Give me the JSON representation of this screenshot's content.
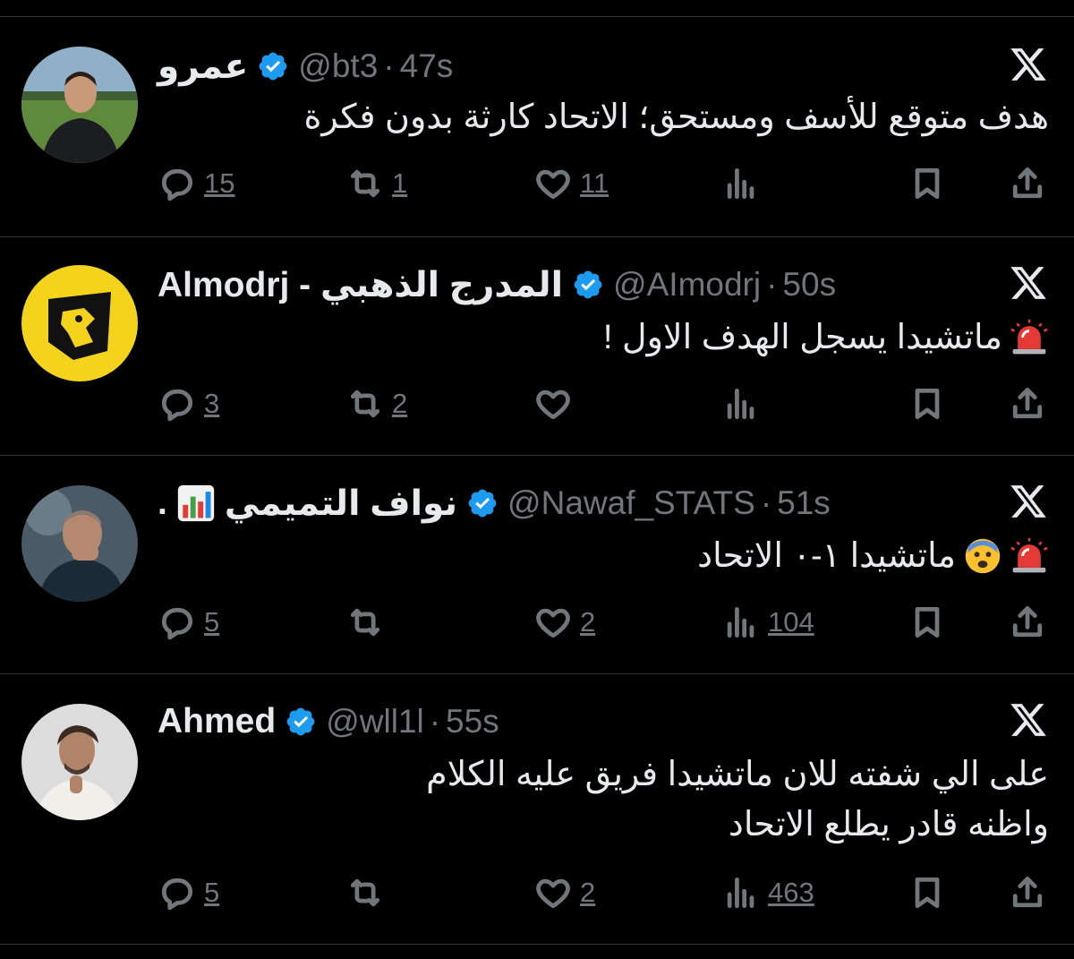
{
  "colors": {
    "background": "#000000",
    "text": "#e7e9ea",
    "muted": "#71767b",
    "verified": "#1d9bf0",
    "divider": "#2f3336"
  },
  "tweets": [
    {
      "name": "عمرو",
      "handle": "@bt3",
      "time": "47s",
      "text_lines": [
        "هدف متوقع للأسف ومستحق؛ الاتحاد كارثة بدون فكرة"
      ],
      "replies": "15",
      "reposts": "1",
      "likes": "11",
      "views": ""
    },
    {
      "name": "Almodrj - المدرج الذهبي",
      "handle": "@AImodrj",
      "time": "50s",
      "text_lines": [
        "ماتشيدا يسجل الهدف الاول !"
      ],
      "text_emoji": "siren-emoji",
      "replies": "3",
      "reposts": "2",
      "likes": "",
      "views": ""
    },
    {
      "name": "نواف التميمي",
      "name_suffix": ".",
      "name_emoji": "bar-chart-emoji",
      "handle": "@Nawaf_STATS",
      "time": "51s",
      "text_lines": [
        "ماتشيدا ١-٠ الاتحاد"
      ],
      "text_emoji": "siren-emoji",
      "text_emoji2": "fearful-face-emoji",
      "replies": "5",
      "reposts": "",
      "likes": "2",
      "views": "104"
    },
    {
      "name": "Ahmed",
      "handle": "@wll1l",
      "time": "55s",
      "text_lines": [
        "على الي شفته للان ماتشيدا فريق عليه الكلام",
        "واظنه قادر يطلع الاتحاد"
      ],
      "replies": "5",
      "reposts": "",
      "likes": "2",
      "views": "463"
    }
  ],
  "separator_dot": "·"
}
